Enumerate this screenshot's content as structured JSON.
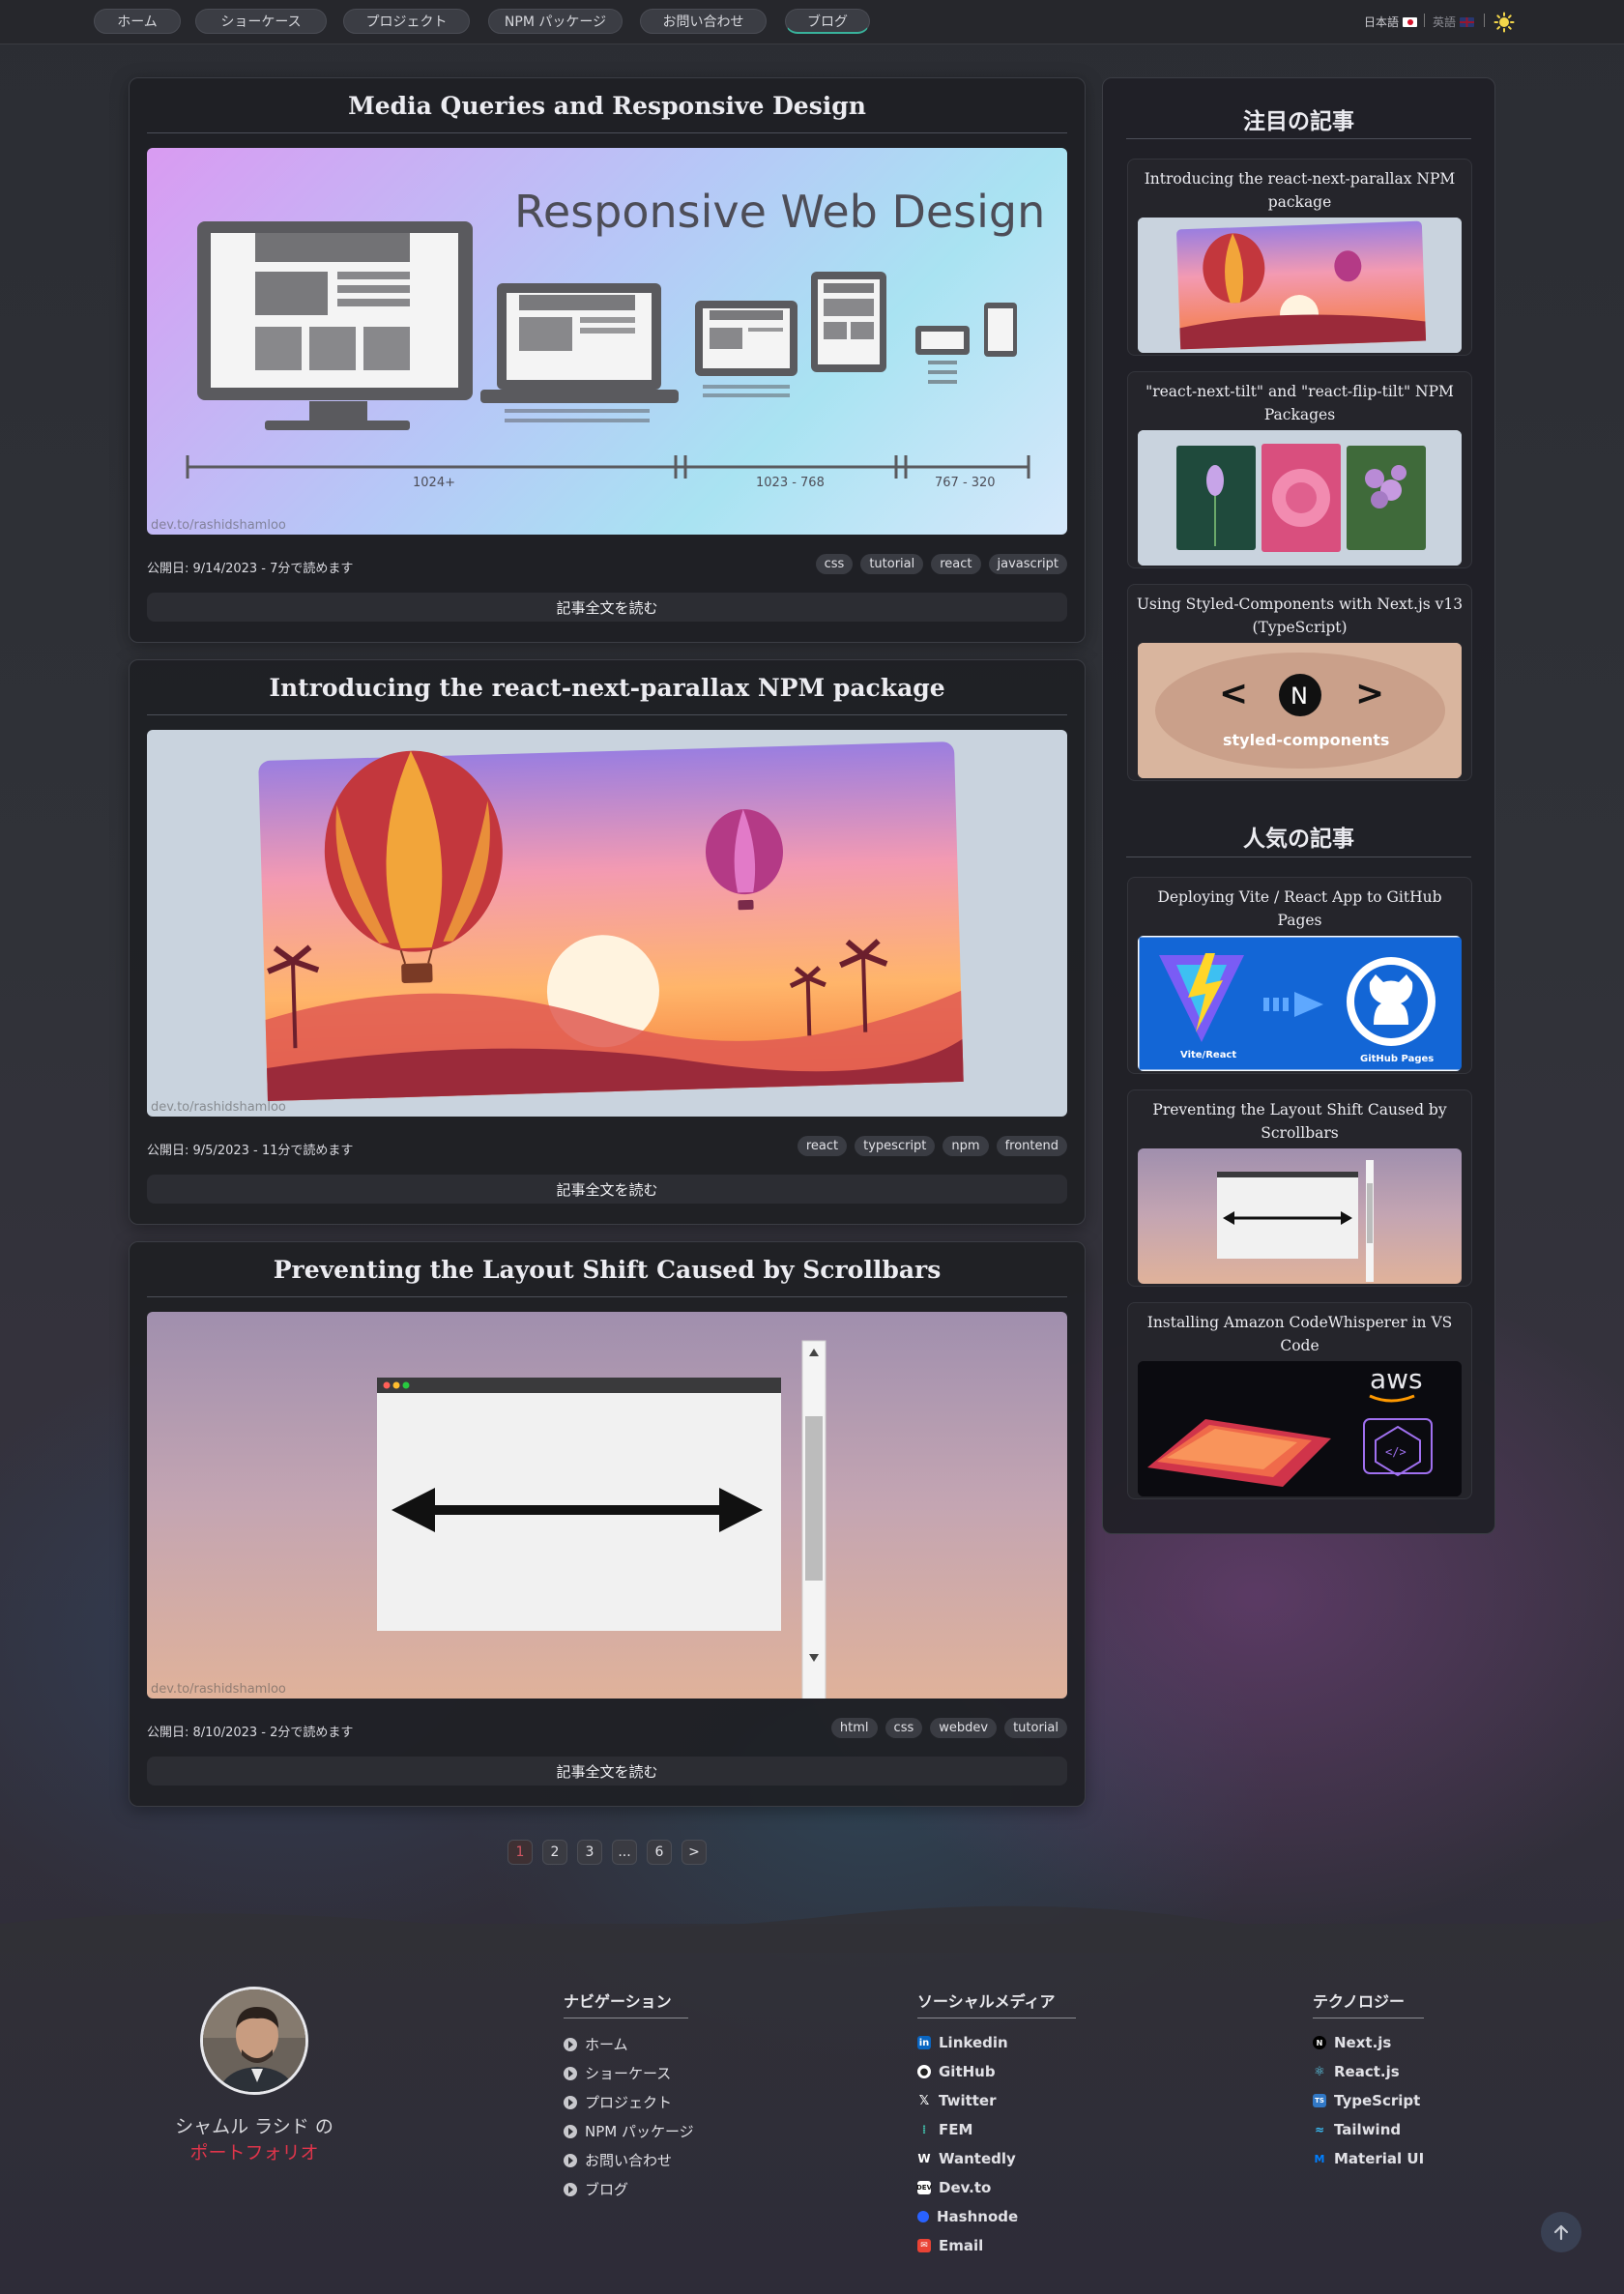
{
  "nav": {
    "items": [
      {
        "label": "ホーム"
      },
      {
        "label": "ショーケース"
      },
      {
        "label": "プロジェクト"
      },
      {
        "label": "NPM パッケージ"
      },
      {
        "label": "お問い合わせ"
      },
      {
        "label": "ブログ"
      }
    ],
    "active": "ブログ",
    "lang_ja": "日本語",
    "lang_en": "英語",
    "theme_icon": "sun-icon"
  },
  "posts": [
    {
      "title": "Media Queries and Responsive Design",
      "image_caption": "Responsive Web Design",
      "breakpoints": [
        "1024+",
        "1023 - 768",
        "767 - 320"
      ],
      "watermark": "dev.to/rashidshamloo",
      "date": "公開日: 9/14/2023 - 7分で読めます",
      "tags": [
        "css",
        "tutorial",
        "react",
        "javascript"
      ],
      "cta": "記事全文を読む"
    },
    {
      "title": "Introducing the react-next-parallax NPM package",
      "watermark": "dev.to/rashidshamloo",
      "date": "公開日: 9/5/2023 - 11分で読めます",
      "tags": [
        "react",
        "typescript",
        "npm",
        "frontend"
      ],
      "cta": "記事全文を読む"
    },
    {
      "title": "Preventing the Layout Shift Caused by Scrollbars",
      "watermark": "dev.to/rashidshamloo",
      "date": "公開日: 8/10/2023 - 2分で読めます",
      "tags": [
        "html",
        "css",
        "webdev",
        "tutorial"
      ],
      "cta": "記事全文を読む"
    }
  ],
  "pagination": {
    "pages": [
      "1",
      "2",
      "3",
      "...",
      "6",
      ">"
    ],
    "current": "1"
  },
  "sidebar": {
    "featured_heading": "注目の記事",
    "featured": [
      {
        "title": "Introducing the react-next-parallax NPM package"
      },
      {
        "title": "\"react-next-tilt\" and \"react-flip-tilt\" NPM Packages"
      },
      {
        "title": "Using Styled-Components with Next.js v13 (TypeScript)",
        "thumb_text": "styled-components"
      }
    ],
    "popular_heading": "人気の記事",
    "popular": [
      {
        "title": "Deploying Vite / React App to GitHub Pages",
        "thumb_left": "Vite/React",
        "thumb_right": "GitHub Pages"
      },
      {
        "title": "Preventing the Layout Shift Caused by Scrollbars"
      },
      {
        "title": "Installing Amazon CodeWhisperer in VS Code",
        "thumb_text": "aws"
      }
    ]
  },
  "footer": {
    "owner_name": "シャムル ラシド の",
    "owner_link": "ポートフォリオ",
    "navigation": {
      "title": "ナビゲーション",
      "items": [
        "ホーム",
        "ショーケース",
        "プロジェクト",
        "NPM パッケージ",
        "お問い合わせ",
        "ブログ"
      ]
    },
    "social": {
      "title": "ソーシャルメディア",
      "items": [
        {
          "label": "Linkedin",
          "icon": "linkedin-icon",
          "color": "#0a66c2"
        },
        {
          "label": "GitHub",
          "icon": "github-icon",
          "color": "#ffffff"
        },
        {
          "label": "Twitter",
          "icon": "x-icon",
          "color": "#ffffff"
        },
        {
          "label": "FEM",
          "icon": "fem-icon",
          "color": "#3fb5a3"
        },
        {
          "label": "Wantedly",
          "icon": "wantedly-icon",
          "color": "#ffffff"
        },
        {
          "label": "Dev.to",
          "icon": "devto-icon",
          "color": "#ffffff"
        },
        {
          "label": "Hashnode",
          "icon": "hashnode-icon",
          "color": "#2962ff"
        },
        {
          "label": "Email",
          "icon": "email-icon",
          "color": "#ea4335"
        }
      ]
    },
    "tech": {
      "title": "テクノロジー",
      "items": [
        {
          "label": "Next.js",
          "icon": "nextjs-icon",
          "color": "#000000"
        },
        {
          "label": "React.js",
          "icon": "react-icon",
          "color": "#61dafb"
        },
        {
          "label": "TypeScript",
          "icon": "typescript-icon",
          "color": "#3178c6"
        },
        {
          "label": "Tailwind",
          "icon": "tailwind-icon",
          "color": "#38bdf8"
        },
        {
          "label": "Material UI",
          "icon": "mui-icon",
          "color": "#007fff"
        }
      ]
    }
  },
  "colors": {
    "accent_teal": "#39b39c",
    "link_red": "#e0354b"
  }
}
